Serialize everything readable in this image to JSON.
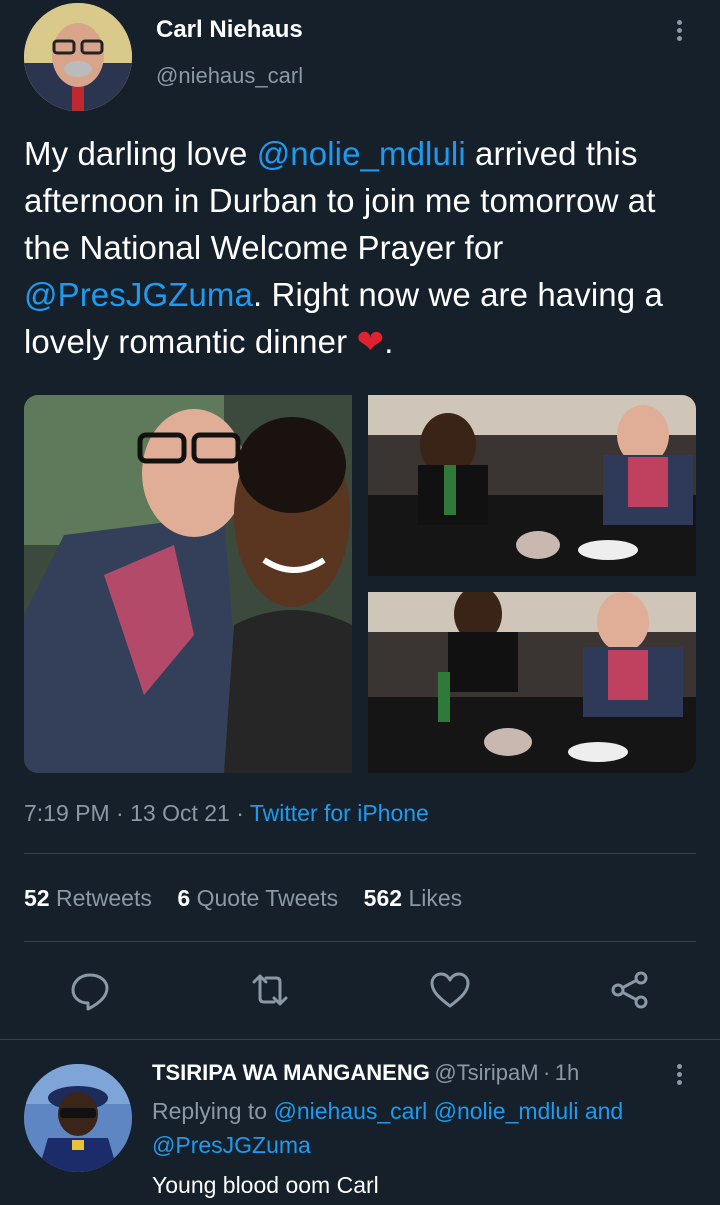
{
  "tweet": {
    "author_name": "Carl Niehaus",
    "author_handle": "@niehaus_carl",
    "text_parts": {
      "p1": "My darling love ",
      "m1": "@nolie_mdluli",
      "p2": " arrived this afternoon in Durban to join me tomorrow at the National Welcome Prayer for ",
      "m2": "@PresJGZuma",
      "p3": ". Right now we are having a lovely romantic dinner ",
      "emoji": "❤",
      "p4": "."
    },
    "time": "7:19 PM",
    "date": "13 Oct 21",
    "source": "Twitter for iPhone",
    "stats": {
      "retweets_count": "52",
      "retweets_label": "Retweets",
      "quotes_count": "6",
      "quotes_label": "Quote Tweets",
      "likes_count": "562",
      "likes_label": "Likes"
    }
  },
  "reply": {
    "author_name": "TSIRIPA WA MANGANENG",
    "author_handle": "@TsiripaM",
    "time": "1h",
    "replying_label": "Replying to",
    "replying_mentions": "@niehaus_carl @nolie_mdluli",
    "and_label": "and",
    "replying_mention_last": "@PresJGZuma",
    "body": "Young blood oom Carl"
  },
  "icons": [
    "more-vertical-icon",
    "reply-icon",
    "retweet-icon",
    "like-icon",
    "share-icon"
  ],
  "colors": {
    "background": "#15202b",
    "accent": "#1d9bf0",
    "secondary": "#8b98a5",
    "divider": "#38444d"
  }
}
